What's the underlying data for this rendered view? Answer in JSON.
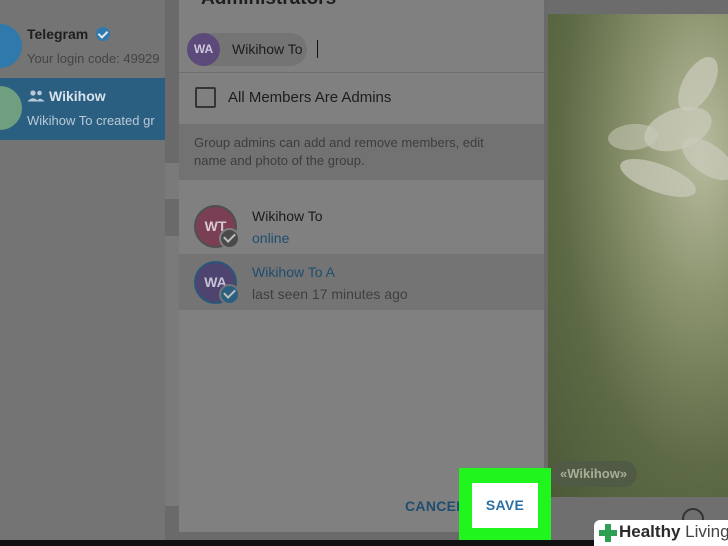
{
  "sidebar": {
    "chats": [
      {
        "title": "Telegram",
        "subtitle": "Your login code: 49929"
      },
      {
        "title": "Wikihow",
        "subtitle": "Wikihow To created gr"
      }
    ]
  },
  "background": {
    "tag": "«Wikihow»"
  },
  "dialog": {
    "title": "Administrators",
    "chip": {
      "initials": "WA",
      "label": "Wikihow To"
    },
    "search_value": "",
    "all_admins_label": "All Members Are Admins",
    "all_admins_checked": false,
    "hint": "Group admins can add and remove members, edit name and photo of the group.",
    "members": [
      {
        "initials": "WT",
        "name": "Wikihow To",
        "status": "online",
        "selected": true
      },
      {
        "initials": "WA",
        "name": "Wikihow To A",
        "status": "last seen 17 minutes ago",
        "selected": true
      }
    ],
    "cancel_label": "CANCEL",
    "save_label": "SAVE"
  },
  "watermark": {
    "brand_bold": "Healthy",
    "brand_light": "Living"
  },
  "colors": {
    "accent": "#2a6fa6",
    "highlight": "#21f51e",
    "sidebar_selected": "#2a5f82"
  }
}
